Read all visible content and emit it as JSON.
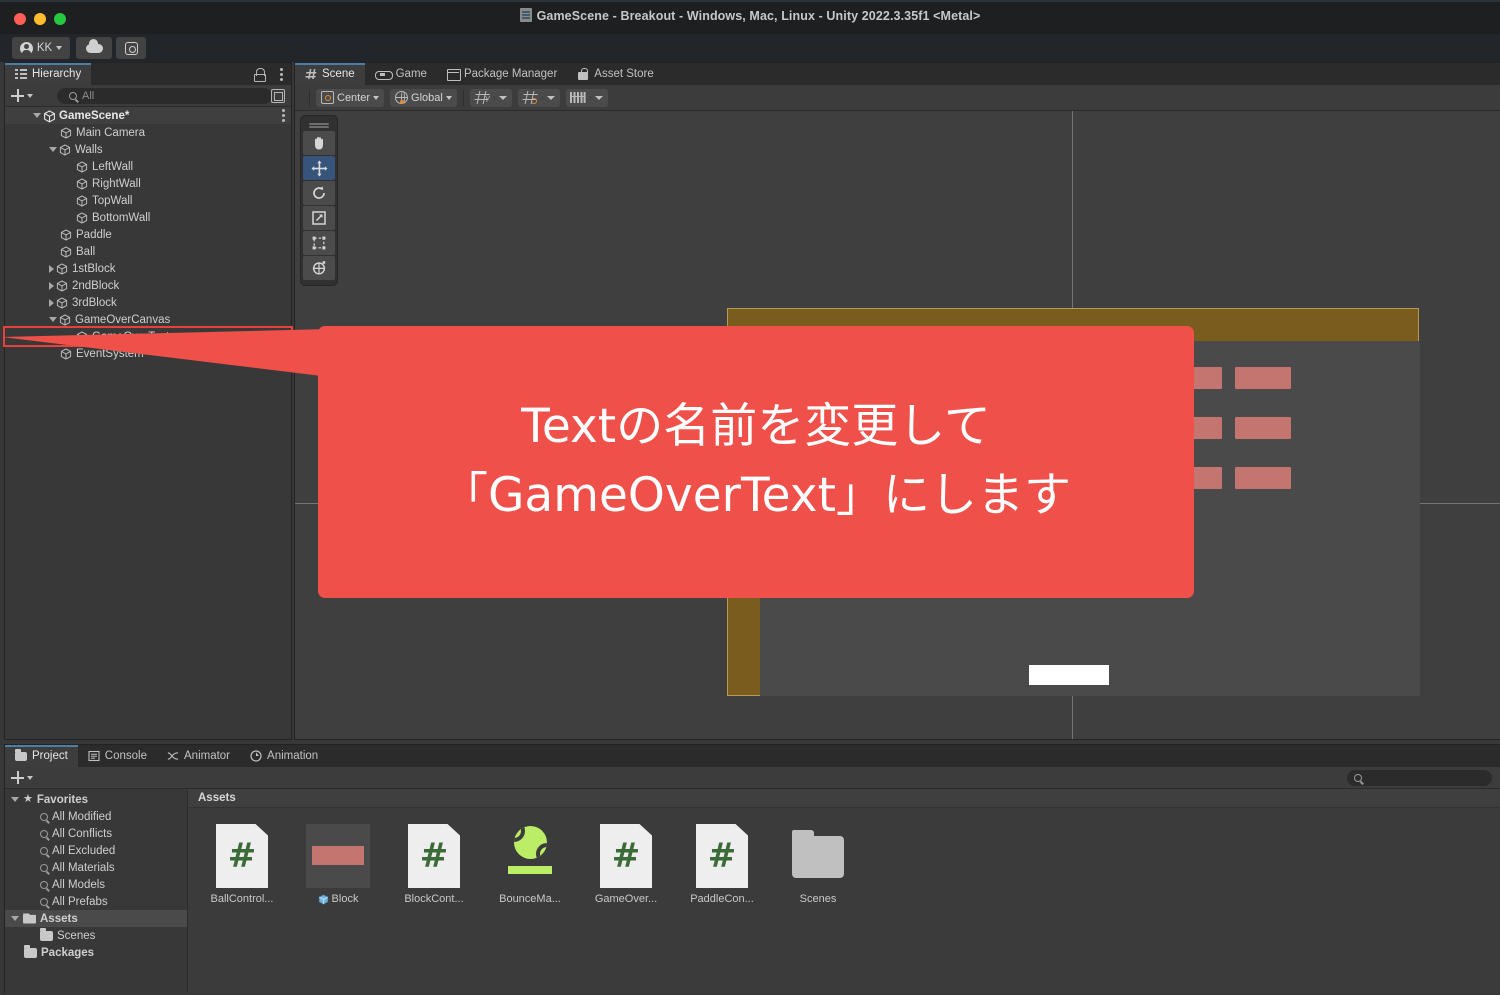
{
  "window": {
    "title": "GameScene - Breakout - Windows, Mac, Linux - Unity 2022.3.35f1 <Metal>",
    "doc_icon": "unity-scene-icon",
    "traffic_lights": [
      "close",
      "minimize",
      "maximize"
    ]
  },
  "toolbar": {
    "account_label": "KK",
    "account_icon": "account-icon",
    "cloud_icon": "cloud-icon",
    "services_icon": "gear-icon",
    "play_icon": "play-icon",
    "pause_icon": "pause-icon",
    "step_icon": "step-icon"
  },
  "hierarchy": {
    "tab_label": "Hierarchy",
    "tab_icon": "hierarchy-icon",
    "lock_icon": "lock-icon",
    "menu_icon": "kebab-menu-icon",
    "add_label": "+",
    "search_placeholder": "All",
    "search_value": "",
    "search_icon": "search-icon",
    "filter_icon": "filter-icon",
    "items": [
      {
        "label": "GameScene*",
        "depth": 0,
        "arrow": "down",
        "icon": "unity-scene-icon",
        "root": true,
        "selected": false
      },
      {
        "label": "Main Camera",
        "depth": 1,
        "arrow": "none",
        "icon": "gameobject-icon",
        "selected": false
      },
      {
        "label": "Walls",
        "depth": 1,
        "arrow": "down",
        "icon": "gameobject-icon",
        "selected": false
      },
      {
        "label": "LeftWall",
        "depth": 2,
        "arrow": "none",
        "icon": "gameobject-icon",
        "selected": false
      },
      {
        "label": "RightWall",
        "depth": 2,
        "arrow": "none",
        "icon": "gameobject-icon",
        "selected": false
      },
      {
        "label": "TopWall",
        "depth": 2,
        "arrow": "none",
        "icon": "gameobject-icon",
        "selected": false
      },
      {
        "label": "BottomWall",
        "depth": 2,
        "arrow": "none",
        "icon": "gameobject-icon",
        "selected": false
      },
      {
        "label": "Paddle",
        "depth": 1,
        "arrow": "none",
        "icon": "gameobject-icon",
        "selected": false
      },
      {
        "label": "Ball",
        "depth": 1,
        "arrow": "none",
        "icon": "gameobject-icon",
        "selected": false
      },
      {
        "label": "1stBlock",
        "depth": 1,
        "arrow": "right",
        "icon": "gameobject-icon",
        "selected": false
      },
      {
        "label": "2ndBlock",
        "depth": 1,
        "arrow": "right",
        "icon": "gameobject-icon",
        "selected": false
      },
      {
        "label": "3rdBlock",
        "depth": 1,
        "arrow": "right",
        "icon": "gameobject-icon",
        "selected": false
      },
      {
        "label": "GameOverCanvas",
        "depth": 1,
        "arrow": "down",
        "icon": "gameobject-icon",
        "selected": false
      },
      {
        "label": "GameOverText",
        "depth": 2,
        "arrow": "none",
        "icon": "gameobject-icon",
        "selected": true
      },
      {
        "label": "EventSystem",
        "depth": 1,
        "arrow": "none",
        "icon": "gameobject-icon",
        "selected": false
      }
    ]
  },
  "scene_view": {
    "tabs": [
      {
        "label": "Scene",
        "icon": "grid-icon",
        "active": true
      },
      {
        "label": "Game",
        "icon": "gamepad-icon",
        "active": false
      },
      {
        "label": "Package Manager",
        "icon": "package-icon",
        "active": false
      },
      {
        "label": "Asset Store",
        "icon": "store-icon",
        "active": false
      }
    ],
    "pivot_mode": "Center",
    "pivot_icon": "pivot-icon",
    "handle_space": "Global",
    "handle_icon": "globe-icon",
    "grid_visibility_icon": "grid-axis-icon",
    "grid_snap_icon": "grid-snap-icon",
    "scene_ruler_icon": "ruler-icon",
    "tools": [
      {
        "name": "hand-tool",
        "active": false
      },
      {
        "name": "move-tool",
        "active": true
      },
      {
        "name": "rotate-tool",
        "active": false
      },
      {
        "name": "scale-tool",
        "active": false
      },
      {
        "name": "rect-tool",
        "active": false
      },
      {
        "name": "transform-tool",
        "active": false
      }
    ]
  },
  "callout": {
    "line1": "Textの名前を変更して",
    "line2": "「GameOverText」にします",
    "color": "#f0504a",
    "text_color": "#ffffff"
  },
  "project": {
    "tabs": [
      {
        "label": "Project",
        "icon": "folder-icon",
        "active": true
      },
      {
        "label": "Console",
        "icon": "console-icon",
        "active": false
      },
      {
        "label": "Animator",
        "icon": "animator-icon",
        "active": false
      },
      {
        "label": "Animation",
        "icon": "animation-icon",
        "active": false
      }
    ],
    "add_label": "+",
    "search_placeholder": "",
    "search_value": "",
    "search_icon": "search-icon",
    "tree": [
      {
        "label": "Favorites",
        "type": "favorites-root",
        "arrow": "down",
        "icon": "star-icon",
        "depth": 0
      },
      {
        "label": "All Modified",
        "type": "saved-search",
        "arrow": "none",
        "icon": "search-icon",
        "depth": 1
      },
      {
        "label": "All Conflicts",
        "type": "saved-search",
        "arrow": "none",
        "icon": "search-icon",
        "depth": 1
      },
      {
        "label": "All Excluded",
        "type": "saved-search",
        "arrow": "none",
        "icon": "search-icon",
        "depth": 1
      },
      {
        "label": "All Materials",
        "type": "saved-search",
        "arrow": "none",
        "icon": "search-icon",
        "depth": 1
      },
      {
        "label": "All Models",
        "type": "saved-search",
        "arrow": "none",
        "icon": "search-icon",
        "depth": 1
      },
      {
        "label": "All Prefabs",
        "type": "saved-search",
        "arrow": "none",
        "icon": "search-icon",
        "depth": 1
      },
      {
        "label": "Assets",
        "type": "folder",
        "arrow": "down",
        "icon": "folder-open-icon",
        "depth": 0,
        "selected": true
      },
      {
        "label": "Scenes",
        "type": "folder",
        "arrow": "none",
        "icon": "folder-icon",
        "depth": 1
      },
      {
        "label": "Packages",
        "type": "folder",
        "arrow": "none",
        "icon": "folder-icon",
        "depth": 0
      }
    ],
    "content_header": "Assets",
    "assets": [
      {
        "label": "BallControl...",
        "kind": "script",
        "icon": "csharp-script-icon"
      },
      {
        "label": "Block",
        "kind": "prefab",
        "icon": "prefab-icon"
      },
      {
        "label": "BlockCont...",
        "kind": "script",
        "icon": "csharp-script-icon"
      },
      {
        "label": "BounceMa...",
        "kind": "material",
        "icon": "material-icon"
      },
      {
        "label": "GameOver...",
        "kind": "script",
        "icon": "csharp-script-icon"
      },
      {
        "label": "PaddleCon...",
        "kind": "script",
        "icon": "csharp-script-icon"
      },
      {
        "label": "Scenes",
        "kind": "folder",
        "icon": "folder-icon"
      }
    ]
  },
  "game_world": {
    "canvas_border_color": "#b89a55",
    "canvas_fill_color": "#7a5c1e",
    "brick_color": "#c4756f",
    "paddle_color": "#ffffff",
    "playfield_color": "#4a4a4a",
    "brick_rows": 3,
    "brick_columns": 7
  }
}
